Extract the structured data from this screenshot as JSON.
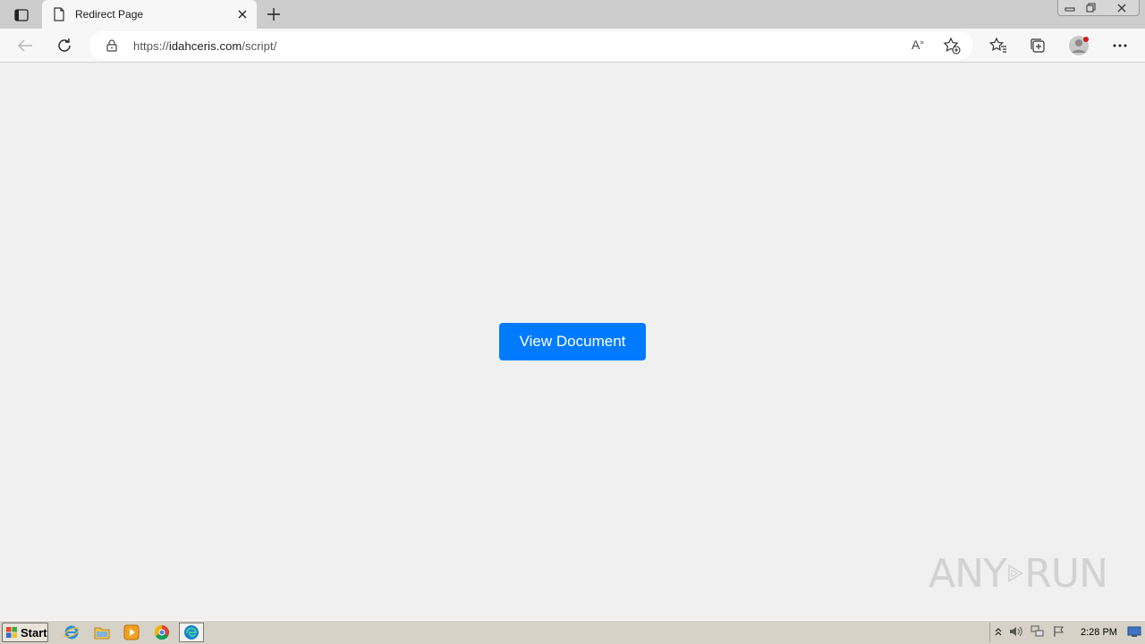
{
  "browser": {
    "tab": {
      "title": "Redirect Page"
    },
    "address": {
      "url_prefix": "https://",
      "url_host": "idahceris.com",
      "url_path": "/script/"
    },
    "read_aloud_label": "A"
  },
  "page": {
    "button_label": "View Document"
  },
  "watermark": {
    "left": "ANY",
    "right": "RUN"
  },
  "taskbar": {
    "start_label": "Start",
    "clock": "2:28 PM"
  },
  "colors": {
    "button": "#007bff",
    "page_bg": "#f0f0f0",
    "taskbar": "#d6d2c7"
  }
}
